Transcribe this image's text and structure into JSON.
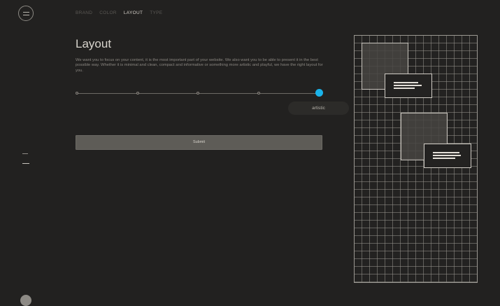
{
  "nav": {
    "items": [
      "BRAND",
      "COLOR",
      "LAYOUT",
      "TYPE"
    ],
    "active_index": 2
  },
  "main": {
    "title": "Layout",
    "description": "We want you to focus on your content, it is the most important part of your website. We also want you to be able to present it in the best possible way. Whether it is minimal and clean, compact and informative or something more artistic and playful, we have the right layout for you."
  },
  "slider": {
    "stops": 5,
    "selected_index": 4,
    "value_fraction": 1.0,
    "selected_label": "artistic",
    "thumb_color": "#1ab3ea"
  },
  "submit": {
    "label": "Submit"
  },
  "icons": {
    "menu": "hamburger-menu-icon",
    "avatar": "user-avatar-icon"
  },
  "colors": {
    "background": "#222120",
    "accent": "#1ab3ea",
    "button": "#5e5c57"
  }
}
